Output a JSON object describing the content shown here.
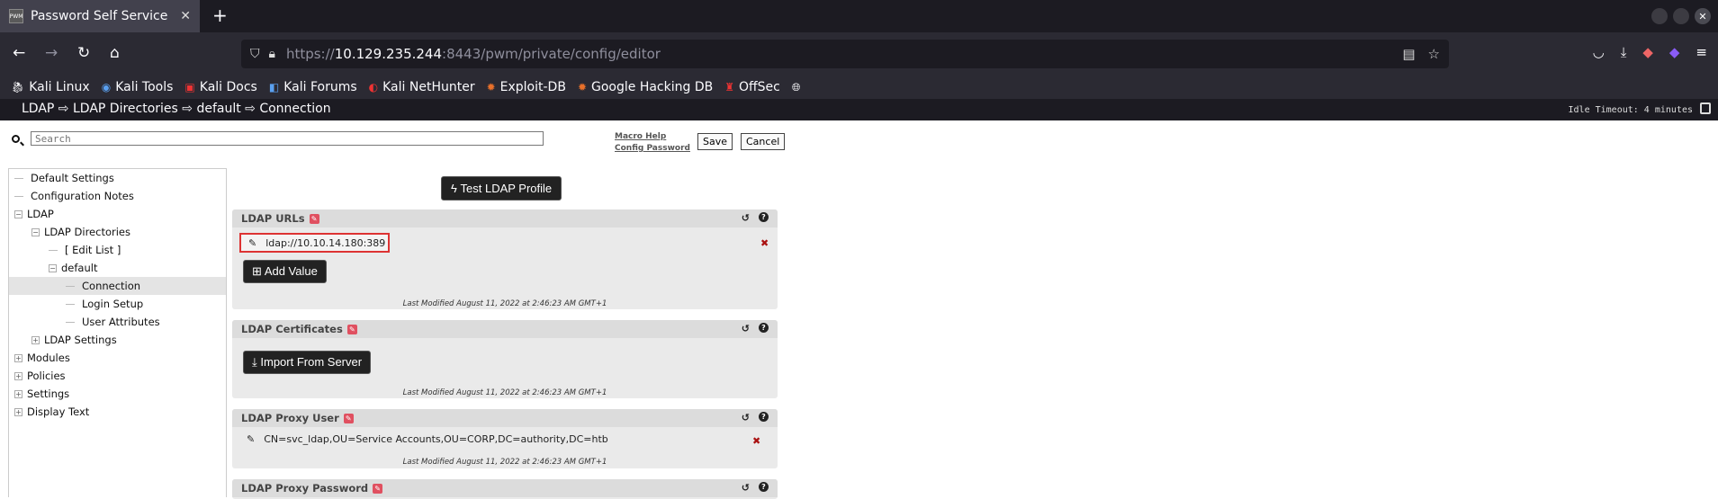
{
  "browser": {
    "tab_title": "Password Self Service",
    "tab_favicon": "PWM",
    "url_host": "https://10.129.235.244",
    "url_rest": ":8443/pwm/private/config/editor",
    "url_host_plain": "https://",
    "url_host_bold": "10.129.235.244",
    "bookmarks": [
      "Kali Linux",
      "Kali Tools",
      "Kali Docs",
      "Kali Forums",
      "Kali NetHunter",
      "Exploit-DB",
      "Google Hacking DB",
      "OffSec"
    ]
  },
  "app": {
    "breadcrumb": "LDAP ⇨ LDAP Directories ⇨ default ⇨ Connection",
    "idle_timeout": "Idle Timeout: 4 minutes"
  },
  "toolbar": {
    "search_placeholder": "Search",
    "macro_help": "Macro Help",
    "config_password": "Config Password",
    "save": "Save",
    "cancel": "Cancel"
  },
  "tree": [
    {
      "label": "Default Settings",
      "level": 0,
      "toggle": null
    },
    {
      "label": "Configuration Notes",
      "level": 0,
      "toggle": null
    },
    {
      "label": "LDAP",
      "level": 0,
      "toggle": "−"
    },
    {
      "label": "LDAP Directories",
      "level": 1,
      "toggle": "−"
    },
    {
      "label": "[ Edit List ]",
      "level": 2,
      "toggle": null
    },
    {
      "label": "default",
      "level": 2,
      "toggle": "−"
    },
    {
      "label": "Connection",
      "level": 3,
      "toggle": null,
      "selected": true
    },
    {
      "label": "Login Setup",
      "level": 3,
      "toggle": null
    },
    {
      "label": "User Attributes",
      "level": 3,
      "toggle": null
    },
    {
      "label": "LDAP Settings",
      "level": 1,
      "toggle": "+"
    },
    {
      "label": "Modules",
      "level": 0,
      "toggle": "+"
    },
    {
      "label": "Policies",
      "level": 0,
      "toggle": "+"
    },
    {
      "label": "Settings",
      "level": 0,
      "toggle": "+"
    },
    {
      "label": "Display Text",
      "level": 0,
      "toggle": "+"
    }
  ],
  "main": {
    "test_button": "Test LDAP Profile",
    "panels": {
      "urls": {
        "title": "LDAP URLs",
        "value": "ldap://10.10.14.180:389",
        "add_value": "Add Value",
        "last_modified": "Last Modified August 11, 2022 at 2:46:23 AM GMT+1"
      },
      "certs": {
        "title": "LDAP Certificates",
        "import": "Import From Server",
        "last_modified": "Last Modified August 11, 2022 at 2:46:23 AM GMT+1"
      },
      "proxy_user": {
        "title": "LDAP Proxy User",
        "value": "CN=svc_ldap,OU=Service Accounts,OU=CORP,DC=authority,DC=htb",
        "last_modified": "Last Modified August 11, 2022 at 2:46:23 AM GMT+1"
      },
      "proxy_password": {
        "title": "LDAP Proxy Password"
      }
    }
  }
}
